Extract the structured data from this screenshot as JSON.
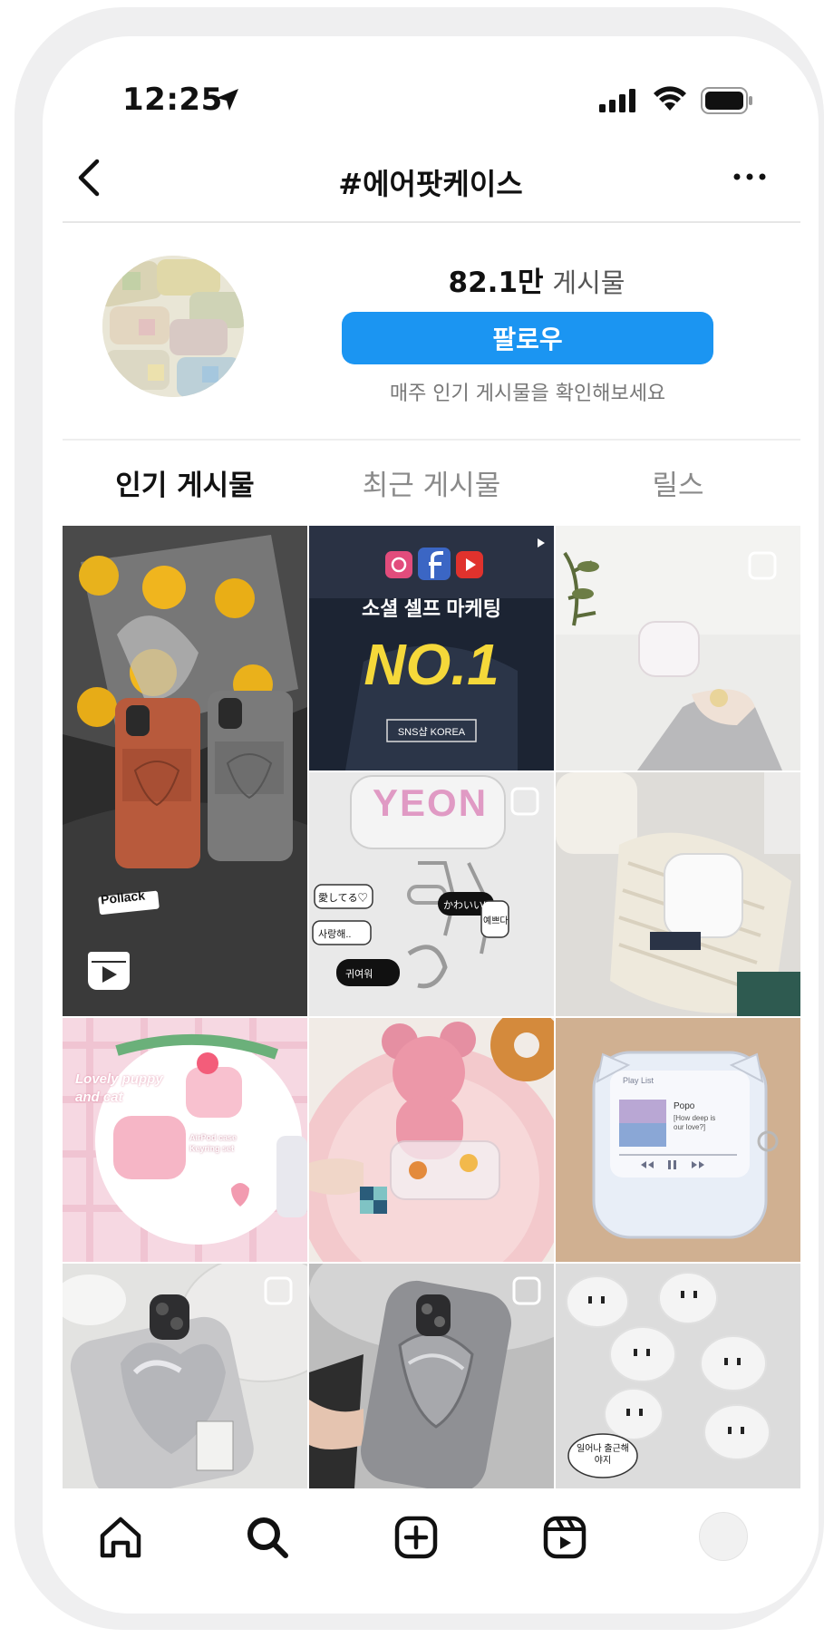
{
  "status_bar": {
    "time": "12:25"
  },
  "header": {
    "title": "#에어팟케이스"
  },
  "profile": {
    "posts_count": "82.1만",
    "posts_label": "게시물",
    "follow_label": "팔로우",
    "helper_text": "매주 인기 게시물을 확인해보세요"
  },
  "tabs": [
    {
      "label": "인기 게시물"
    },
    {
      "label": "최근 게시물"
    },
    {
      "label": "릴스"
    }
  ],
  "grid": {
    "tile1_sticker": "Pollack",
    "ad_title": "소셜 셀프 마케팅",
    "ad_headline": "NO.1",
    "ad_badge": "SNS샵 KOREA",
    "tile5_name": "YEON",
    "tile5_tag1": "愛してる♡",
    "tile5_tag2": "사랑해..",
    "tile5_tag3": "かわいい!",
    "tile5_tag4": "귀여워",
    "tile5_tag5": "예쁘다",
    "tile7_title": "Lovely puppy and cat",
    "tile7_sub": "AirPod case Keyring set",
    "tile9_header": "Play List",
    "tile9_song": "Popo",
    "tile9_lyric": "[How deep is our love?]",
    "tile12_speech": "일어나 출근해야지"
  },
  "colors": {
    "accent": "#1b95f2",
    "text_primary": "#111111",
    "text_secondary": "#8a8a8a"
  }
}
